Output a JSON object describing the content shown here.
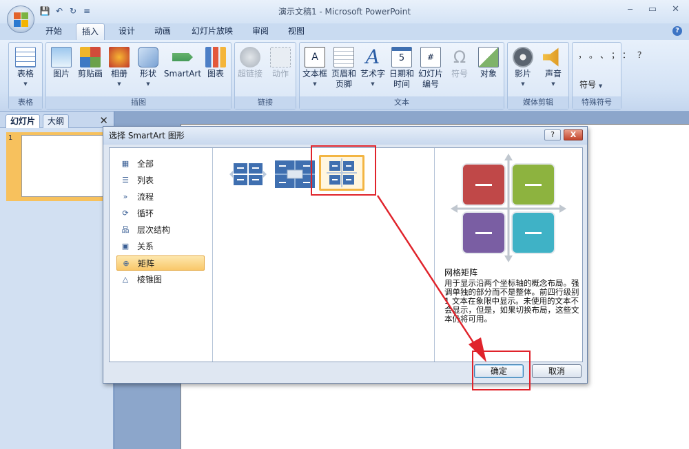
{
  "window": {
    "title": "演示文稿1 - Microsoft PowerPoint",
    "minimize": "‒",
    "restore": "▭",
    "close": "✕"
  },
  "qat": {
    "save": "💾",
    "undo": "↶",
    "redo": "↻",
    "more": "≡"
  },
  "tabs": [
    "开始",
    "插入",
    "设计",
    "动画",
    "幻灯片放映",
    "审阅",
    "视图"
  ],
  "active_tab": "插入",
  "help": "?",
  "ribbon": {
    "groups": {
      "tables": "表格",
      "illustrations": "插图",
      "links": "链接",
      "text": "文本",
      "media": "媒体剪辑",
      "special": "特殊符号"
    },
    "buttons": {
      "table": "表格",
      "picture": "图片",
      "clipart": "剪贴画",
      "album": "相册",
      "shapes": "形状",
      "smartart": "SmartArt",
      "chart": "图表",
      "hyperlink": "超链接",
      "action": "动作",
      "textbox": "文本框",
      "header1": "页眉和",
      "header2": "页脚",
      "wordart": "艺术字",
      "datetime1": "日期和",
      "datetime2": "时间",
      "slidenum1": "幻灯片",
      "slidenum2": "编号",
      "symbol": "符号",
      "object": "对象",
      "movie": "影片",
      "sound": "声音",
      "special_symbol": "符号",
      "special_chars": "，。、；：？"
    }
  },
  "side_panel": {
    "tab_slides": "幻灯片",
    "tab_outline": "大纲",
    "close": "✕",
    "slide_number": "1"
  },
  "dialog": {
    "title": "选择 SmartArt 图形",
    "help": "?",
    "close": "X",
    "categories": [
      "全部",
      "列表",
      "流程",
      "循环",
      "层次结构",
      "关系",
      "矩阵",
      "棱锥图"
    ],
    "selected_category": "矩阵",
    "preview_title": "网格矩阵",
    "preview_desc": "用于显示沿两个坐标轴的概念布局。强调单独的部分而不是整体。前四行级别 1 文本在象限中显示。未使用的文本不会显示，但是，如果切换布局，这些文本仍将可用。",
    "ok": "确定",
    "cancel": "取消"
  },
  "colors": {
    "accent": "#e0232b",
    "selected": "#f9c86a",
    "q1": "#c04848",
    "q2": "#8db33f",
    "q3": "#7a5ea3",
    "q4": "#3fb2c6"
  }
}
